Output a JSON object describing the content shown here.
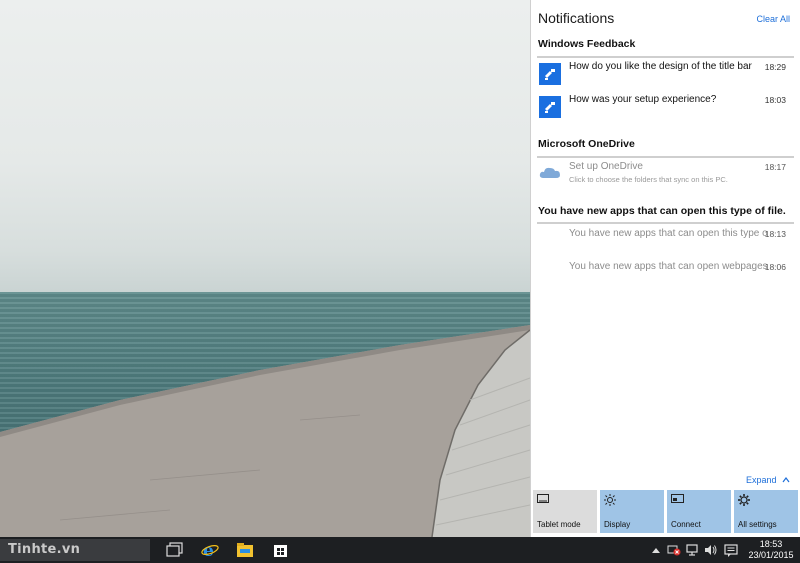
{
  "action_center": {
    "title": "Notifications",
    "clear_all": "Clear All",
    "groups": [
      {
        "header": "Windows Feedback",
        "items": [
          {
            "text": "How do you like the design of the title bar",
            "time": "18:29",
            "icon": "feedback-icon"
          },
          {
            "text": "How was your setup experience?",
            "time": "18:03",
            "icon": "feedback-icon"
          }
        ]
      },
      {
        "header": "Microsoft OneDrive",
        "items": [
          {
            "text": "Set up OneDrive",
            "sub": "Click to choose the folders that sync on this PC.",
            "time": "18:17",
            "icon": "onedrive-cloud-icon"
          }
        ]
      },
      {
        "header": "You have new apps that can open this type of file.",
        "items": [
          {
            "text": "You have new apps that can open this type of file.",
            "time": "18:13"
          },
          {
            "text": "You have new apps that can open webpages.",
            "time": "18:06"
          }
        ]
      }
    ],
    "expand": "Expand",
    "quick_actions": [
      {
        "label": "Tablet mode",
        "icon": "tablet-mode-icon",
        "state": "off"
      },
      {
        "label": "Display",
        "icon": "brightness-icon",
        "state": "on"
      },
      {
        "label": "Connect",
        "icon": "connect-icon",
        "state": "on"
      },
      {
        "label": "All settings",
        "icon": "gear-icon",
        "state": "on"
      }
    ]
  },
  "taskbar": {
    "search_text": "Tinhte.vn",
    "apps": [
      "task-view-icon",
      "internet-explorer-icon",
      "file-explorer-icon",
      "store-icon"
    ],
    "tray": [
      "chevron-up-icon",
      "power-icon",
      "network-icon",
      "volume-icon",
      "action-center-icon"
    ],
    "time": "18:53",
    "date": "23/01/2015"
  },
  "colors": {
    "accent": "#1e6fd9",
    "tile_blue": "#1a6fe0",
    "quick_on": "#9fc4e6",
    "quick_off": "#dcdcdc",
    "taskbar": "#1d1f22"
  }
}
